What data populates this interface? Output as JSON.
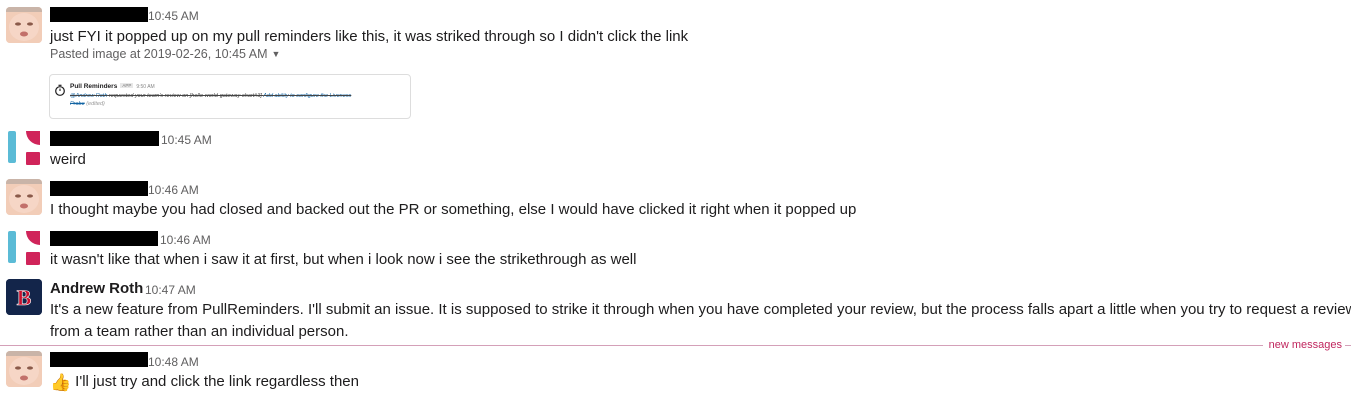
{
  "messages": [
    {
      "author": "",
      "time": "10:45 AM",
      "text": "just FYI it popped up on my pull reminders like this, it was striked through so I didn't click the link",
      "attachment": {
        "label": "Pasted image at 2019-02-26, 10:45 AM",
        "preview": {
          "app_name": "Pull Reminders",
          "badge": "APP",
          "time": "9:50 AM",
          "text_mention": "@Andrew Roth",
          "text_middle": " requested your team's review on [hello-world-gateway-chart#3] ",
          "text_link": "Add ability to configure the Liveness",
          "text_link_cont": "Probe",
          "edited": "(edited)"
        }
      }
    },
    {
      "author": "",
      "time": "10:45 AM",
      "text": "weird"
    },
    {
      "author": "",
      "time": "10:46 AM",
      "text": "I thought maybe you had closed and backed out the PR or something, else I would have clicked it right when it popped up"
    },
    {
      "author": "",
      "time": "10:46 AM",
      "text": "it wasn't like that when i saw it at first, but when i look now i see the strikethrough as well"
    },
    {
      "author": "Andrew Roth",
      "time": "10:47 AM",
      "text_line1": "It's a new feature from PullReminders. I'll submit an issue. It is supposed to strike it through when you have completed your review, but the process falls apart a little when you try to request a review",
      "text_line2": "from a team rather than an individual person."
    },
    {
      "author": "",
      "time": "10:48 AM",
      "emoji": "👍",
      "text": "I'll just try and click the link regardless then"
    }
  ],
  "divider": {
    "label": "new messages"
  },
  "colors": {
    "accent_pink": "#c0265e",
    "logo_blue": "#5bbbd6",
    "logo_red": "#d0245a",
    "sox_navy": "#13254a"
  }
}
